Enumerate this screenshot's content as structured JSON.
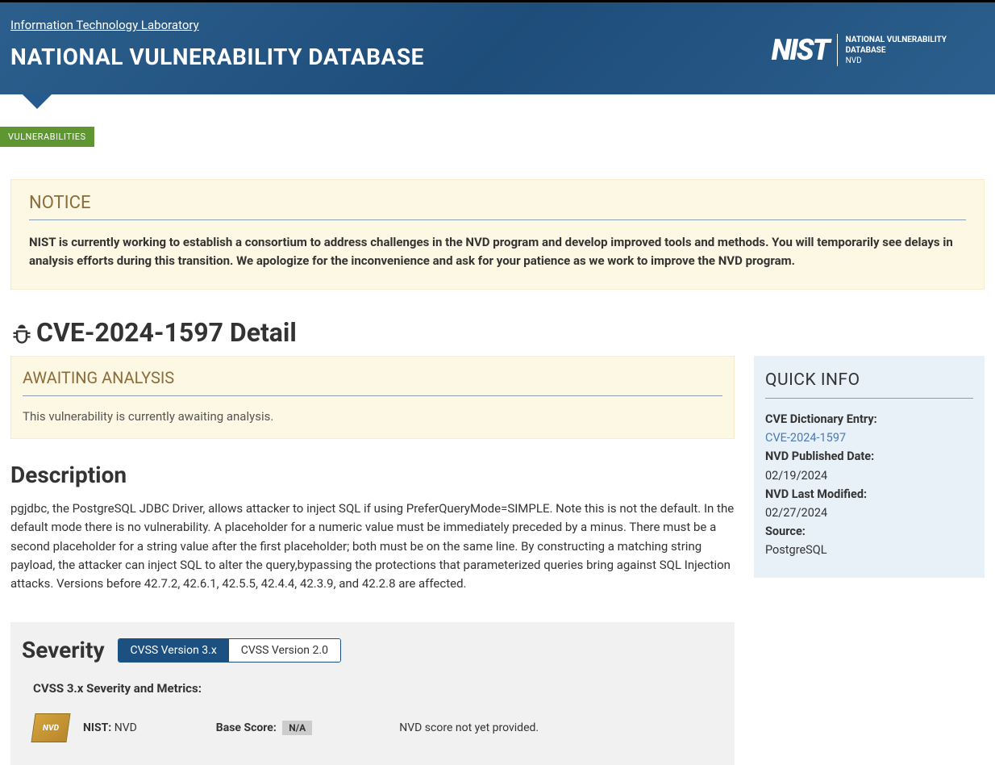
{
  "header": {
    "itl_link": "Information Technology Laboratory",
    "title": "NATIONAL VULNERABILITY DATABASE",
    "logo_main": "NIST",
    "logo_line1": "NATIONAL VULNERABILITY",
    "logo_line2": "DATABASE",
    "logo_line3": "NVD"
  },
  "breadcrumb": "VULNERABILITIES",
  "notice": {
    "heading": "NOTICE",
    "text": "NIST is currently working to establish a consortium to address challenges in the NVD program and develop improved tools and methods. You will temporarily see delays in analysis efforts during this transition. We apologize for the inconvenience and ask for your patience as we work to improve the NVD program."
  },
  "cve": {
    "title": "CVE-2024-1597 Detail"
  },
  "awaiting": {
    "heading": "AWAITING ANALYSIS",
    "text": "This vulnerability is currently awaiting analysis."
  },
  "description": {
    "heading": "Description",
    "text": "pgjdbc, the PostgreSQL JDBC Driver, allows attacker to inject SQL if using PreferQueryMode=SIMPLE. Note this is not the default. In the default mode there is no vulnerability. A placeholder for a numeric value must be immediately preceded by a minus. There must be a second placeholder for a string value after the first placeholder; both must be on the same line. By constructing a matching string payload, the attacker can inject SQL to alter the query,bypassing the protections that parameterized queries bring against SQL Injection attacks. Versions before 42.7.2, 42.6.1, 42.5.5, 42.4.4, 42.3.9, and 42.2.8 are affected."
  },
  "severity": {
    "heading": "Severity",
    "tab_active": "CVSS Version 3.x",
    "tab_inactive": "CVSS Version 2.0",
    "sub": "CVSS 3.x Severity and Metrics:",
    "nist_label": "NIST:",
    "nist_value": "NVD",
    "base_label": "Base Score:",
    "na": "N/A",
    "no_score": "NVD score not yet provided.",
    "badge_text": "NVD"
  },
  "quickinfo": {
    "heading": "QUICK INFO",
    "entry_label": "CVE Dictionary Entry:",
    "entry_value": "CVE-2024-1597",
    "published_label": "NVD Published Date:",
    "published_value": "02/19/2024",
    "modified_label": "NVD Last Modified:",
    "modified_value": "02/27/2024",
    "source_label": "Source:",
    "source_value": "PostgreSQL"
  }
}
